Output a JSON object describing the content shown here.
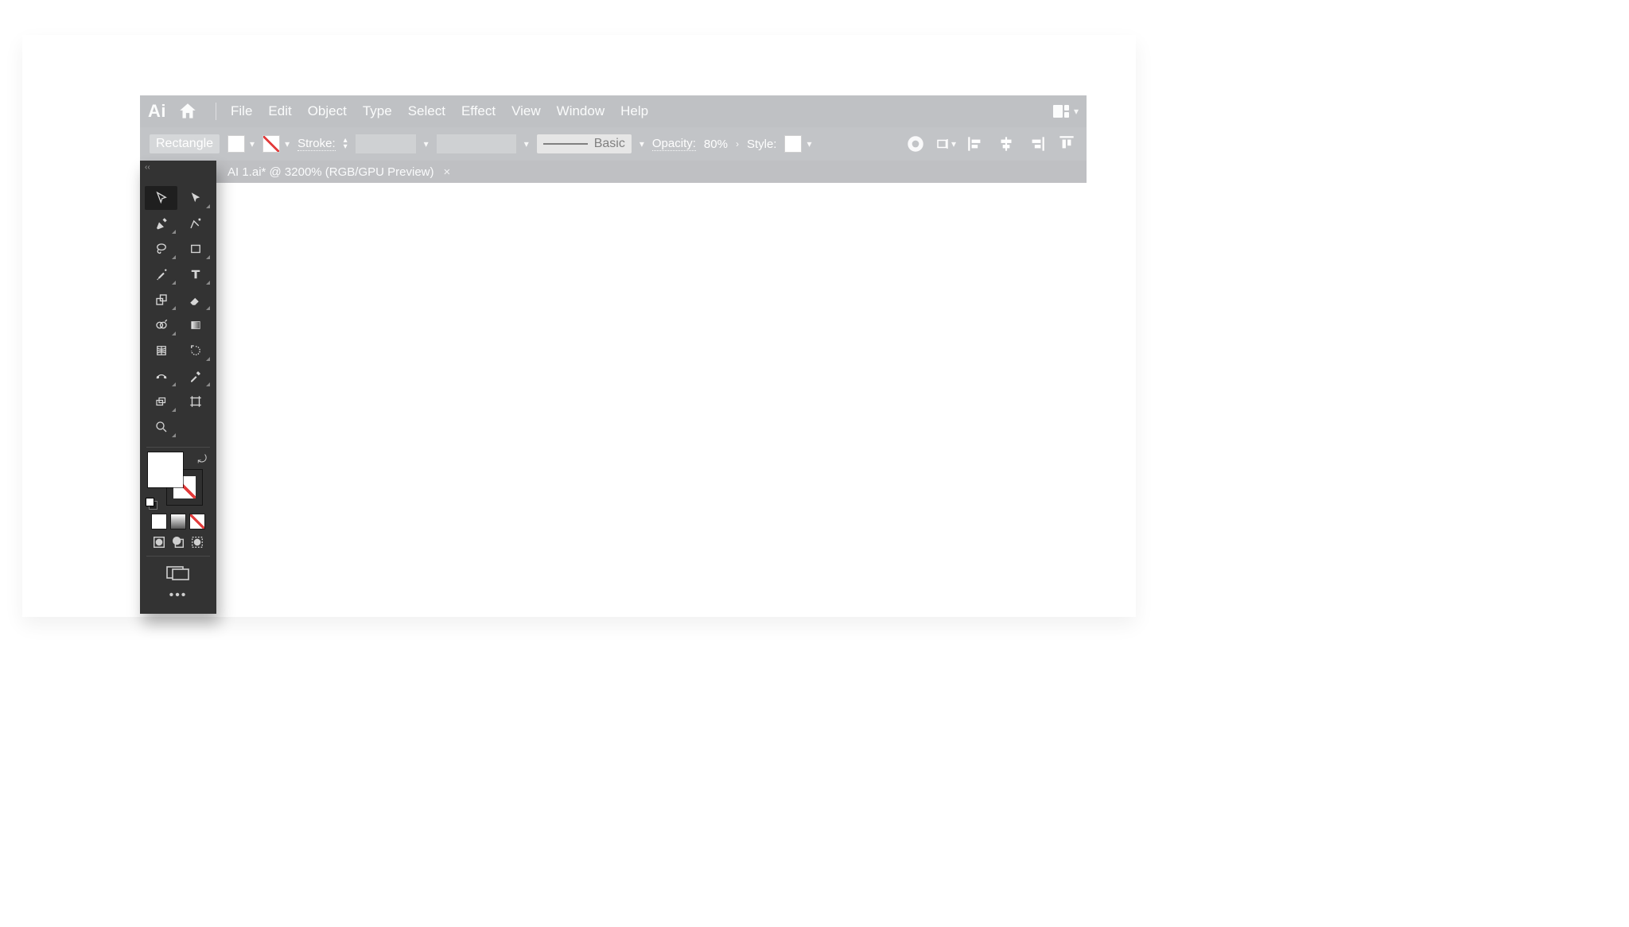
{
  "app": {
    "brand": "Ai",
    "menuItems": [
      "File",
      "Edit",
      "Object",
      "Type",
      "Select",
      "Effect",
      "View",
      "Window",
      "Help"
    ]
  },
  "control": {
    "shapeReadout": "Rectangle",
    "fillColor": "#ffffff",
    "strokeNone": true,
    "strokeLabel": "Stroke:",
    "brushName": "Basic",
    "opacityLabel": "Opacity:",
    "opacityValue": "80%",
    "styleLabel": "Style:"
  },
  "tab": {
    "title": "AI 1.ai* @ 3200% (RGB/GPU Preview)"
  },
  "tools": {
    "panelMenu": "‹‹",
    "subheader": "",
    "zoomLabel": "zoom",
    "fillColor": "#ffffff",
    "strokeNone": true
  }
}
